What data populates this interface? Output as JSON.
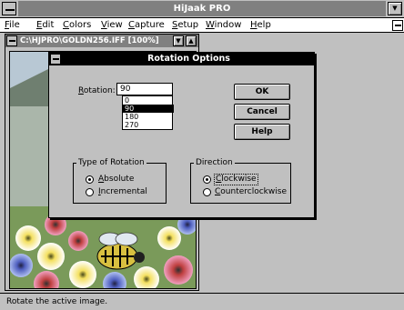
{
  "app": {
    "title": "HiJaak PRO"
  },
  "menu": [
    {
      "label": "File",
      "u": "F",
      "rest": "ile"
    },
    {
      "label": "Edit",
      "u": "E",
      "rest": "dit"
    },
    {
      "label": "Colors",
      "u": "C",
      "rest": "olors"
    },
    {
      "label": "View",
      "u": "V",
      "rest": "iew"
    },
    {
      "label": "Capture",
      "u": "C",
      "rest": "apture"
    },
    {
      "label": "Setup",
      "u": "S",
      "rest": "etup"
    },
    {
      "label": "Window",
      "u": "W",
      "rest": "indow"
    },
    {
      "label": "Help",
      "u": "H",
      "rest": "elp"
    }
  ],
  "child": {
    "title": "C:\\HJPRO\\GOLDN256.IFF [100%]"
  },
  "dialog": {
    "title": "Rotation Options",
    "rotation_label_u": "R",
    "rotation_label_rest": "otation:",
    "rotation_value": "90",
    "rotation_options": [
      "0",
      "90",
      "180",
      "270"
    ],
    "selected_option": "90",
    "ok": "OK",
    "cancel": "Cancel",
    "help": "Help",
    "type_group": "Type of Rotation",
    "absolute_u": "A",
    "absolute_rest": "bsolute",
    "incremental_u": "I",
    "incremental_rest": "ncremental",
    "direction_group": "Direction",
    "clockwise_u": "C",
    "clockwise_rest": "lockwise",
    "counter_u": "C",
    "counter_rest": "ounterclockwise",
    "type_selected": "Absolute",
    "direction_selected": "Clockwise"
  },
  "status": {
    "text": "Rotate the active image."
  },
  "icons": {
    "system_menu": "system-menu-icon",
    "maximize": "maximize-icon",
    "minimize": "minimize-icon"
  }
}
